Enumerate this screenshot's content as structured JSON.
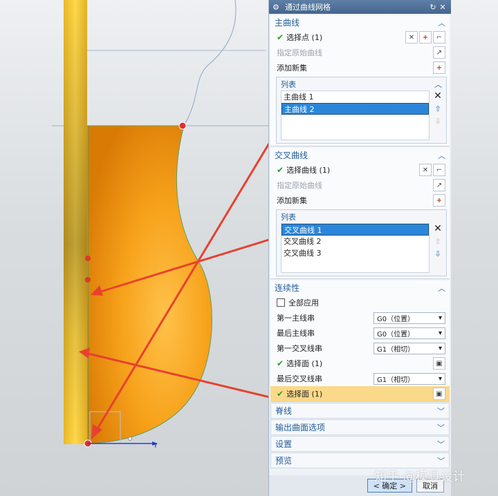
{
  "dialog": {
    "title": "通过曲线网格",
    "primary": {
      "header": "主曲线",
      "select_label": "选择点 (1)",
      "specify_origin": "指定原始曲线",
      "add_set": "添加新集",
      "list_header": "列表",
      "items": [
        "主曲线 1",
        "主曲线 2"
      ]
    },
    "cross": {
      "header": "交叉曲线",
      "select_label": "选择曲线 (1)",
      "specify_origin": "指定原始曲线",
      "add_set": "添加新集",
      "list_header": "列表",
      "items": [
        "交叉曲线 1",
        "交叉曲线 2",
        "交叉曲线 3"
      ]
    },
    "continuity": {
      "header": "连续性",
      "apply_all": "全部应用",
      "first_primary_label": "第一主线串",
      "first_primary_value": "G0（位置）",
      "last_primary_label": "最后主线串",
      "last_primary_value": "G0（位置）",
      "first_cross_label": "第一交叉线串",
      "first_cross_value": "G1（相切）",
      "face_select_1": "选择面 (1)",
      "last_cross_label": "最后交叉线串",
      "last_cross_value": "G1（相切）",
      "face_select_2": "选择面 (1)"
    },
    "collapsed": [
      "脊线",
      "输出曲面选项",
      "设置",
      "预览"
    ],
    "ok_label": "< 确定 >",
    "cancel_label": "取消"
  },
  "viewport": {
    "axis_label": "Y"
  },
  "watermark": "知乎 @模具设计",
  "colors": {
    "accent": "#1f5c99",
    "selection": "#2b86d9",
    "highlight": "#fbd98a",
    "body": "#f5a623",
    "arrow": "#e8412f"
  }
}
